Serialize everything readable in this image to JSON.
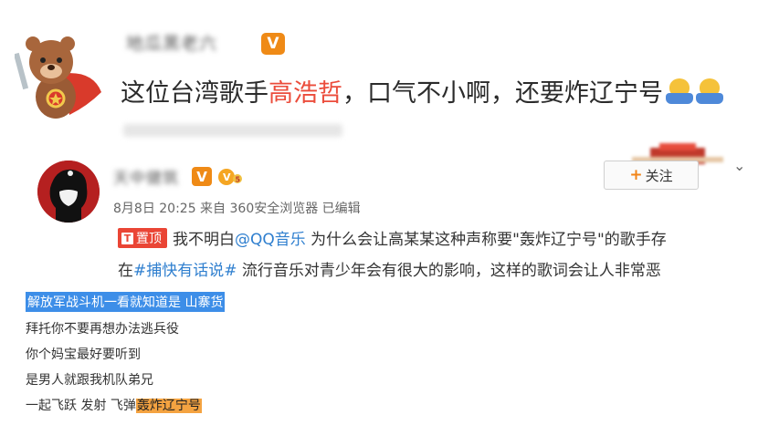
{
  "top_post": {
    "username": "地瓜黑老六",
    "verified_badge": "V",
    "text_before": "这位台湾歌手",
    "text_highlight": "高浩哲",
    "text_after": "，口气不小啊，还要炸辽宁号",
    "emoji": "emoji-shrug-icon",
    "highlight_color": "#eb4c3b"
  },
  "post": {
    "username": "天中健筑",
    "verified_badge": "V",
    "vip_icon": "vip-crown-icon",
    "meta": "8月8日 20:25 来自 360安全浏览器  已编辑",
    "follow_label": "关注",
    "follow_plus": "+",
    "pin_arrow": "T",
    "pin_label": "置顶",
    "body_line1_a": "我不明白",
    "body_mention": "@QQ音乐",
    "body_line1_b": " 为什么会让高某某这种声称要\"轰炸辽宁号\"的歌手存",
    "body_line2_a": "在",
    "body_hashtag": "#捕快有话说#",
    "body_line2_b": " 流行音乐对青少年会有很大的影响，这样的歌词会让人非常恶",
    "link_color": "#2f7fcf",
    "pin_color": "#ea4535"
  },
  "lyrics": {
    "line1": "解放军战斗机一看就知道是 山寨货",
    "line2": "拜托你不要再想办法逃兵役",
    "line3": "你个妈宝最好要听到",
    "line4": "是男人就跟我机队弟兄",
    "line5_a": "一起飞跃 发射 飞弹",
    "line5_b": "轰炸辽宁号",
    "selection_color": "#3d8ee8",
    "highlight_color": "#f4a341"
  }
}
